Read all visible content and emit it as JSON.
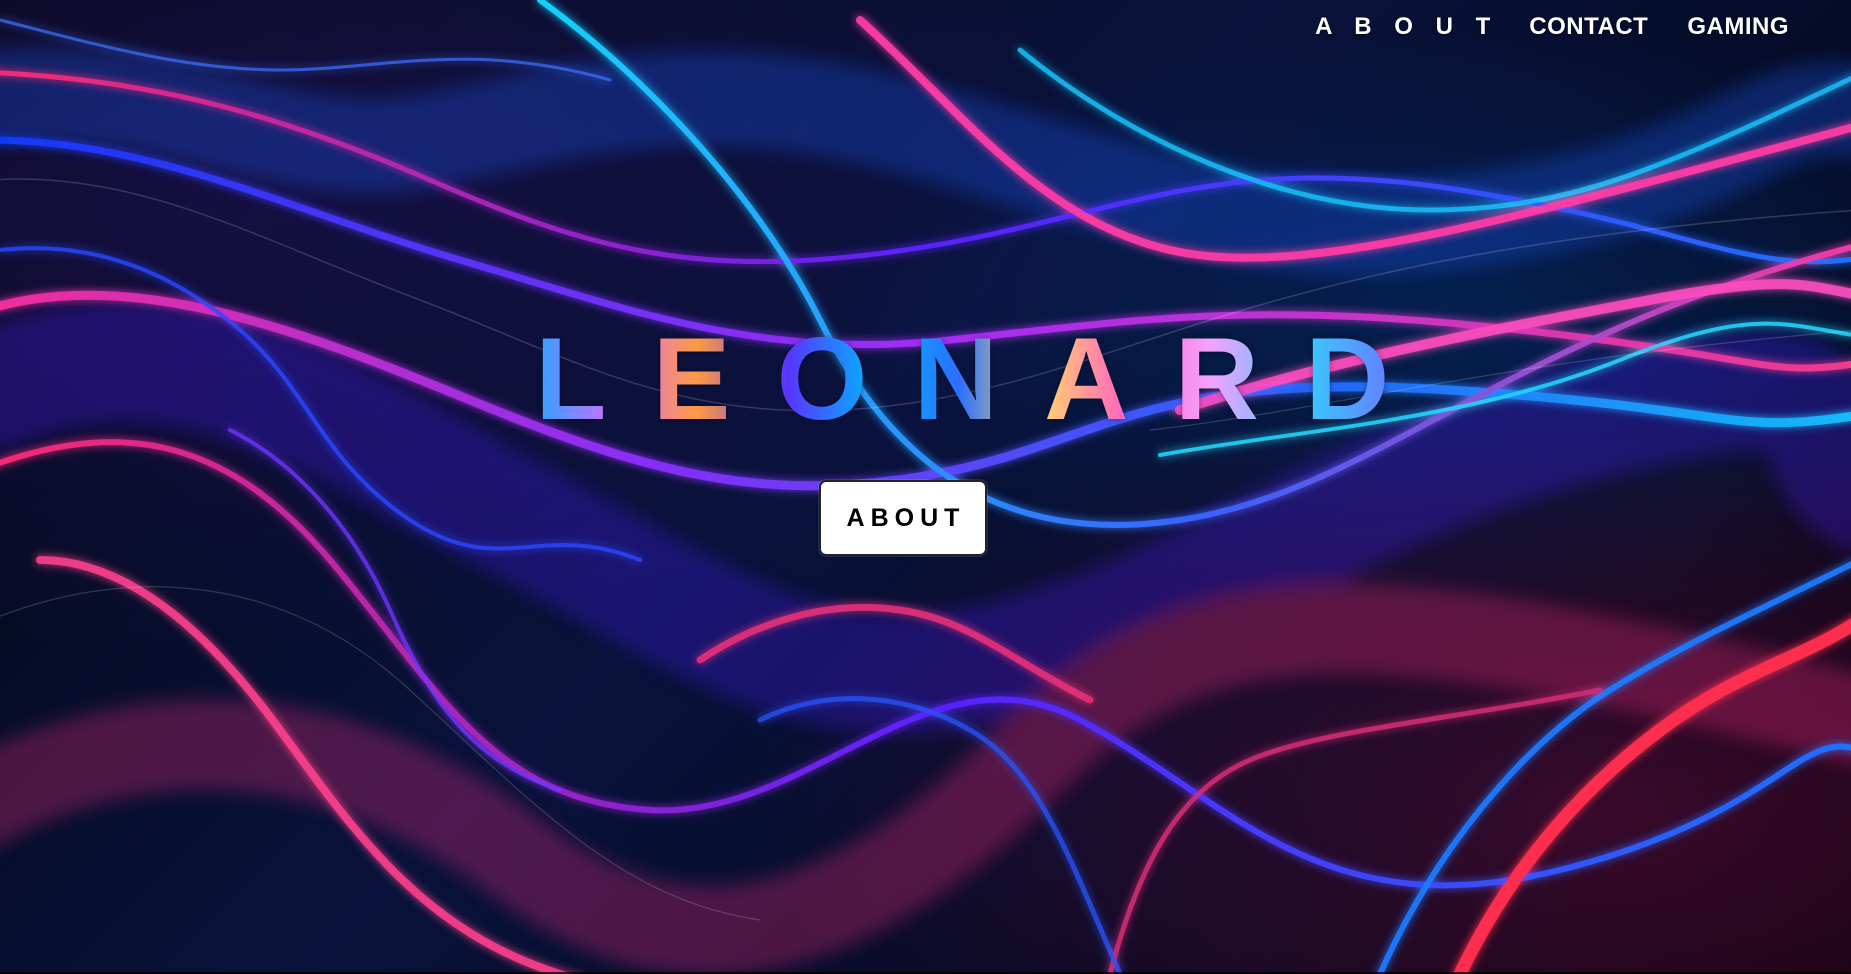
{
  "nav": {
    "links": [
      "A B O U T",
      "CONTACT",
      "GAMING"
    ]
  },
  "hero": {
    "title": "LEONARD",
    "button_label": "ABOUT"
  },
  "colors": {
    "background": "#03030d",
    "button_bg": "#ffffff",
    "button_text": "#000000",
    "nav_text": "#ffffff",
    "accent_blue": "#1f66ff",
    "accent_pink": "#ff4f9b",
    "accent_purple": "#8b2cff"
  }
}
